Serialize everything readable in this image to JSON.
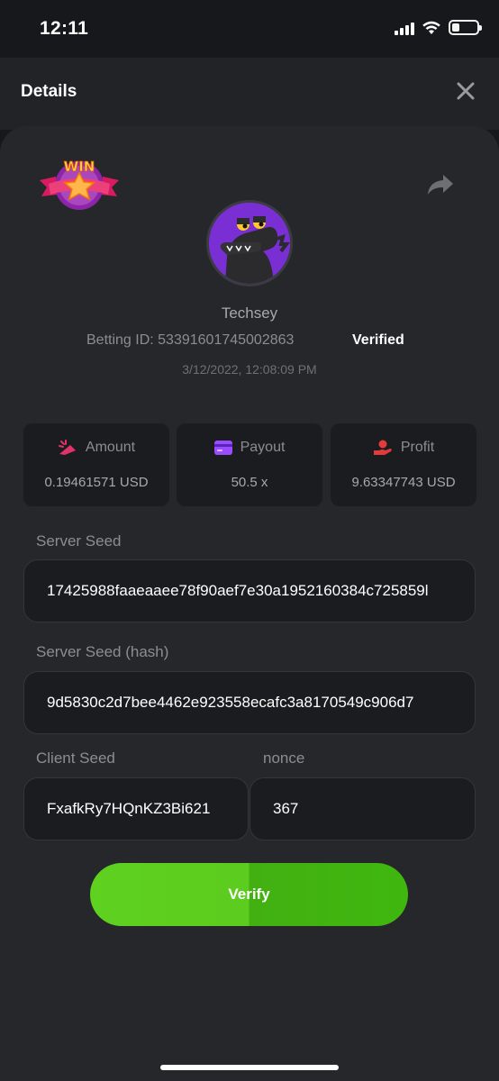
{
  "status_bar": {
    "time": "12:11"
  },
  "header": {
    "title": "Details"
  },
  "user": {
    "name": "Techsey",
    "betting_id": "Betting ID: 53391601745002863",
    "verified_label": "Verified",
    "datetime": "3/12/2022, 12:08:09 PM"
  },
  "badge": {
    "text": "WIN"
  },
  "stats": {
    "amount": {
      "label": "Amount",
      "value": "0.19461571 USD"
    },
    "payout": {
      "label": "Payout",
      "value": "50.5 x"
    },
    "profit": {
      "label": "Profit",
      "value": "9.63347743 USD"
    }
  },
  "fields": {
    "server_seed": {
      "label": "Server Seed",
      "value": "17425988faaeaaee78f90aef7e30a1952160384c725859l"
    },
    "server_seed_hash": {
      "label": "Server Seed (hash)",
      "value": "9d5830c2d7bee4462e923558ecafc3a8170549c906d7"
    },
    "client_seed": {
      "label": "Client Seed",
      "value": "FxafkRy7HQnKZ3Bi621"
    },
    "nonce": {
      "label": "nonce",
      "value": "367"
    }
  },
  "verify_button": {
    "label": "Verify"
  },
  "icons": {
    "close": "close-icon",
    "share": "share-icon",
    "amount": "amount-icon",
    "payout": "card-icon",
    "profit": "profit-icon"
  },
  "colors": {
    "accent": "#5ccc1e",
    "amount_icon": "#e0336b",
    "payout_icon": "#9a4dff",
    "profit_icon": "#e33b3b"
  }
}
